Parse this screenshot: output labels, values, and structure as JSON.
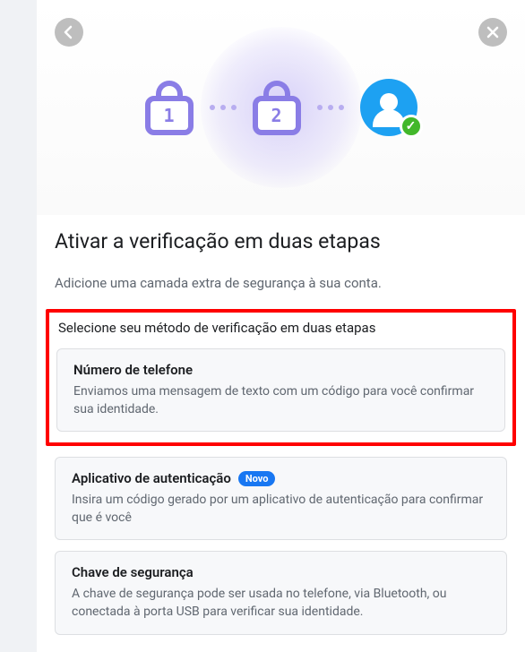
{
  "illustration": {
    "lock1": "1",
    "lock2": "2",
    "check": "✓"
  },
  "modal": {
    "title": "Ativar a verificação em duas etapas",
    "subtitle": "Adicione uma camada extra de segurança à sua conta.",
    "section_label": "Selecione seu método de verificação em duas etapas",
    "options": [
      {
        "title": "Número de telefone",
        "desc": "Enviamos uma mensagem de texto com um código para você confirmar sua identidade."
      },
      {
        "title": "Aplicativo de autenticação",
        "badge": "Novo",
        "desc": "Insira um código gerado por um aplicativo de autenticação para confirmar que é você"
      },
      {
        "title": "Chave de segurança",
        "desc": "A chave de segurança pode ser usada no telefone, via Bluetooth, ou conectada à porta USB para verificar sua identidade."
      }
    ]
  }
}
